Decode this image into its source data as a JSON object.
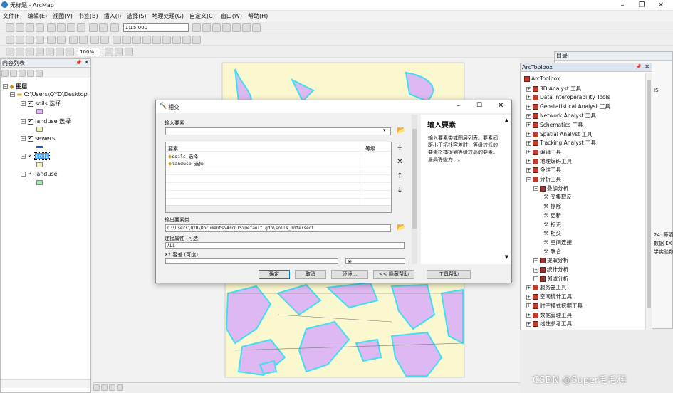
{
  "window": {
    "title": "无标题 - ArcMap"
  },
  "menu": [
    "文件(F)",
    "编辑(E)",
    "视图(V)",
    "书签(B)",
    "插入(I)",
    "选择(S)",
    "地理处理(G)",
    "自定义(C)",
    "窗口(W)",
    "帮助(H)"
  ],
  "toolbar": {
    "scale": "1:15,000",
    "zoom": "100%"
  },
  "toc": {
    "title": "内容列表",
    "layers_group": "图层",
    "folder": "C:\\Users\\QYD\\Desktop",
    "layers": [
      {
        "name": "soils 选择",
        "checked": true,
        "color": "#ddb8f2"
      },
      {
        "name": "landuse 选择",
        "checked": true,
        "color": "#f4f1b8"
      },
      {
        "name": "sewers",
        "checked": true,
        "color": "#1f5fbf"
      },
      {
        "name": "soils",
        "checked": true,
        "color": "#f4f1b8",
        "selected": true
      },
      {
        "name": "landuse",
        "checked": true,
        "color": "#a7e4b2"
      }
    ]
  },
  "dialog": {
    "title": "相交",
    "input_label": "输入要素",
    "input_value": "",
    "table_header_feature": "要素",
    "table_header_rank": "等级",
    "features": [
      "soils 选择",
      "landuse 选择"
    ],
    "output_label": "输出要素类",
    "output_value": "C:\\Users\\QYD\\Documents\\ArcGIS\\Default.gdb\\soils_Intersect",
    "join_label": "连接属性 (可选)",
    "join_value": "ALL",
    "tolerance_label": "XY 容差 (可选)",
    "tolerance_unit": "米",
    "buttons": {
      "ok": "确定",
      "cancel": "取消",
      "env": "环境...",
      "hide": "<< 隐藏帮助",
      "help": "工具帮助"
    },
    "help_title": "输入要素",
    "help_text": "输入要素类或图层列表。要素间距小于拓扑容差时，等级较低的要素将捕捉到等级较高的要素。最高等级为一。"
  },
  "catalog": {
    "title": "目录"
  },
  "arctoolbox": {
    "title": "ArcToolbox",
    "root": "ArcToolbox",
    "items": [
      {
        "label": "3D Analyst 工具",
        "level": 1,
        "kind": "box",
        "sign": "+"
      },
      {
        "label": "Data Interoperability Tools",
        "level": 1,
        "kind": "box",
        "sign": "+"
      },
      {
        "label": "Geostatistical Analyst 工具",
        "level": 1,
        "kind": "box",
        "sign": "+"
      },
      {
        "label": "Network Analyst 工具",
        "level": 1,
        "kind": "box",
        "sign": "+"
      },
      {
        "label": "Schematics 工具",
        "level": 1,
        "kind": "box",
        "sign": "+"
      },
      {
        "label": "Spatial Analyst 工具",
        "level": 1,
        "kind": "box",
        "sign": "+"
      },
      {
        "label": "Tracking Analyst 工具",
        "level": 1,
        "kind": "box",
        "sign": "+"
      },
      {
        "label": "编辑工具",
        "level": 1,
        "kind": "box",
        "sign": "+"
      },
      {
        "label": "地理编码工具",
        "level": 1,
        "kind": "box",
        "sign": "+"
      },
      {
        "label": "多维工具",
        "level": 1,
        "kind": "box",
        "sign": "+"
      },
      {
        "label": "分析工具",
        "level": 1,
        "kind": "box",
        "sign": "-"
      },
      {
        "label": "叠加分析",
        "level": 2,
        "kind": "set",
        "sign": "-"
      },
      {
        "label": "交集取反",
        "level": 3,
        "kind": "tool",
        "sign": ""
      },
      {
        "label": "擦除",
        "level": 3,
        "kind": "tool",
        "sign": ""
      },
      {
        "label": "更新",
        "level": 3,
        "kind": "tool",
        "sign": ""
      },
      {
        "label": "标识",
        "level": 3,
        "kind": "tool",
        "sign": ""
      },
      {
        "label": "相交",
        "level": 3,
        "kind": "tool",
        "sign": ""
      },
      {
        "label": "空间连接",
        "level": 3,
        "kind": "tool",
        "sign": ""
      },
      {
        "label": "联合",
        "level": 3,
        "kind": "tool",
        "sign": ""
      },
      {
        "label": "提取分析",
        "level": 2,
        "kind": "set",
        "sign": "+"
      },
      {
        "label": "统计分析",
        "level": 2,
        "kind": "set",
        "sign": "+"
      },
      {
        "label": "邻域分析",
        "level": 2,
        "kind": "set",
        "sign": "+"
      },
      {
        "label": "服务器工具",
        "level": 1,
        "kind": "box",
        "sign": "+"
      },
      {
        "label": "空间统计工具",
        "level": 1,
        "kind": "box",
        "sign": "+"
      },
      {
        "label": "时空模式挖掘工具",
        "level": 1,
        "kind": "box",
        "sign": "+"
      },
      {
        "label": "数据管理工具",
        "level": 1,
        "kind": "box",
        "sign": "+"
      },
      {
        "label": "线性参考工具",
        "level": 1,
        "kind": "box",
        "sign": "+"
      }
    ]
  },
  "right_fragments": [
    "IS",
    "24: 等项",
    "数据 EX",
    "学实验数"
  ],
  "watermark": "CSDN @Super毛毛穗"
}
